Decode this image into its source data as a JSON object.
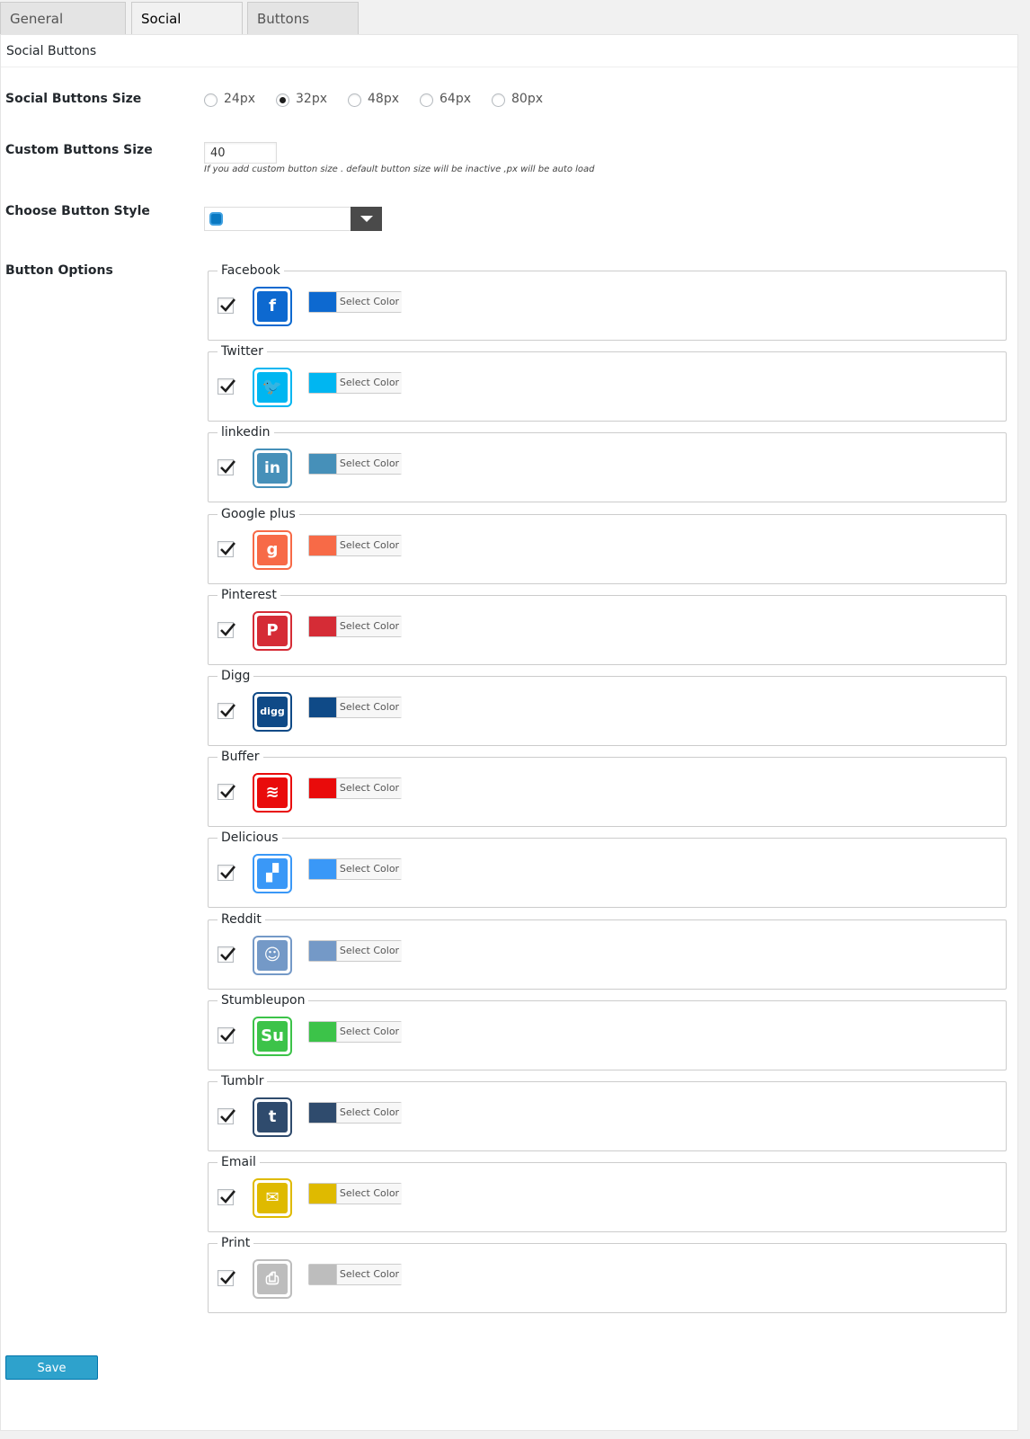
{
  "tabs": [
    {
      "label": "General Settings",
      "active": false
    },
    {
      "label": "Social Buttons",
      "active": true
    },
    {
      "label": "Buttons Effect",
      "active": false
    }
  ],
  "panel_title": "Social Buttons",
  "size_row": {
    "label": "Social Buttons Size",
    "options": [
      "24px",
      "32px",
      "48px",
      "64px",
      "80px"
    ],
    "selected": "32px"
  },
  "custom_size": {
    "label": "Custom Buttons Size",
    "value": "40",
    "help": "If you add custom button size . default button size will be inactive ,px will be auto load"
  },
  "style_row": {
    "label": "Choose Button Style"
  },
  "options_row": {
    "label": "Button Options"
  },
  "buttons": [
    {
      "name": "Facebook",
      "color": "#0d69d0",
      "glyph": "f",
      "icon": "facebook-icon",
      "checked": true
    },
    {
      "name": "Twitter",
      "color": "#00b6f1",
      "glyph": "🐦",
      "icon": "twitter-icon",
      "checked": true
    },
    {
      "name": "linkedin",
      "color": "#4690b9",
      "glyph": "in",
      "icon": "linkedin-icon",
      "checked": true
    },
    {
      "name": "Google plus",
      "color": "#f76a47",
      "glyph": "g",
      "icon": "google-plus-icon",
      "checked": true
    },
    {
      "name": "Pinterest",
      "color": "#d52c36",
      "glyph": "P",
      "icon": "pinterest-icon",
      "checked": true
    },
    {
      "name": "Digg",
      "color": "#0f4a87",
      "glyph": "digg",
      "icon": "digg-icon",
      "checked": true
    },
    {
      "name": "Buffer",
      "color": "#e90b0b",
      "glyph": "≋",
      "icon": "buffer-icon",
      "checked": true
    },
    {
      "name": "Delicious",
      "color": "#3a98f7",
      "glyph": "▞",
      "icon": "delicious-icon",
      "checked": true
    },
    {
      "name": "Reddit",
      "color": "#7499c7",
      "glyph": "☺",
      "icon": "reddit-icon",
      "checked": true
    },
    {
      "name": "Stumbleupon",
      "color": "#3cc349",
      "glyph": "Su",
      "icon": "stumbleupon-icon",
      "checked": true
    },
    {
      "name": "Tumblr",
      "color": "#2f4b6d",
      "glyph": "t",
      "icon": "tumblr-icon",
      "checked": true
    },
    {
      "name": "Email",
      "color": "#dfba00",
      "glyph": "✉",
      "icon": "email-icon",
      "checked": true
    },
    {
      "name": "Print",
      "color": "#bdbdbd",
      "glyph": "⎙",
      "icon": "print-icon",
      "checked": true
    }
  ],
  "select_color_label": "Select Color",
  "save_label": "Save Changes"
}
